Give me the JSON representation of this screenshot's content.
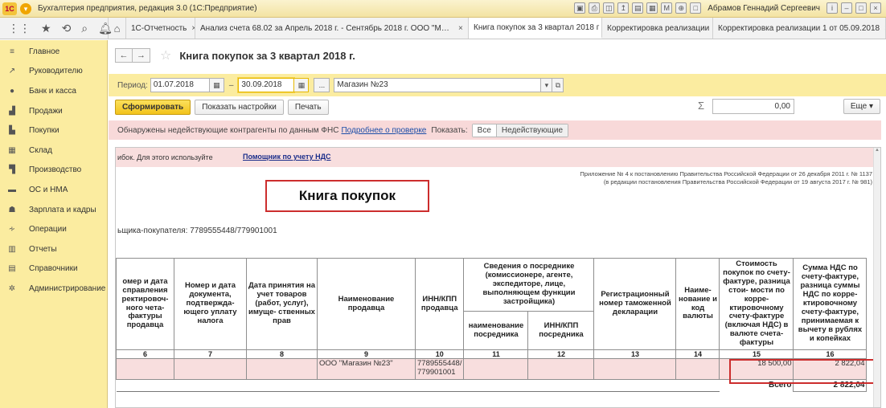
{
  "window": {
    "title": "Бухгалтерия предприятия, редакция 3.0  (1С:Предприятие)",
    "user": "Абрамов Геннадий Сергеевич"
  },
  "tabs": [
    {
      "label": "1С-Отчетность"
    },
    {
      "label": "Анализ счета 68.02 за Апрель 2018 г. - Сентябрь 2018 г. ООО \"Магазин ..."
    },
    {
      "label": "Книга покупок за 3 квартал 2018 г"
    },
    {
      "label": "Корректировка реализации"
    },
    {
      "label": "Корректировка реализации 1 от 05.09.2018"
    }
  ],
  "sidebar": {
    "items": [
      {
        "label": "Главное",
        "icon": "menu-lines-icon"
      },
      {
        "label": "Руководителю",
        "icon": "trend-icon"
      },
      {
        "label": "Банк и касса",
        "icon": "coin-icon"
      },
      {
        "label": "Продажи",
        "icon": "cart-icon"
      },
      {
        "label": "Покупки",
        "icon": "basket-icon"
      },
      {
        "label": "Склад",
        "icon": "warehouse-icon"
      },
      {
        "label": "Производство",
        "icon": "factory-icon"
      },
      {
        "label": "ОС и НМА",
        "icon": "truck-icon"
      },
      {
        "label": "Зарплата и кадры",
        "icon": "person-icon"
      },
      {
        "label": "Операции",
        "icon": "operations-icon"
      },
      {
        "label": "Отчеты",
        "icon": "bar-chart-icon"
      },
      {
        "label": "Справочники",
        "icon": "book-icon"
      },
      {
        "label": "Администрирование",
        "icon": "gear-icon"
      }
    ]
  },
  "header": {
    "title": "Книга покупок за 3 квартал 2018 г."
  },
  "filter": {
    "period_label": "Период:",
    "date_from": "01.07.2018",
    "dash": "–",
    "date_to": "30.09.2018",
    "dots": "...",
    "org": "Магазин №23"
  },
  "actions": {
    "generate": "Сформировать",
    "settings": "Показать настройки",
    "print": "Печать",
    "sum_value": "0,00",
    "more": "Еще"
  },
  "warning": {
    "text": "Обнаружены недействующие контрагенты по данным ФНС",
    "link": "Подробнее о проверке",
    "show_label": "Показать:",
    "seg_all": "Все",
    "seg_inactive": "Недействующие"
  },
  "report": {
    "pink_text": "ибок. Для этого используйте",
    "pink_link": "Помощник по учету НДС",
    "note1": "Приложение № 4 к постановлению Правительства Российской Федерации от 26 декабря 2011 г. № 1137",
    "note2": "(в редакции постановления Правительства Российской Федерации от 19 августа 2017 г. № 981)",
    "title": "Книга покупок",
    "inn_line": "ьщика-покупателя:   7789555448/779901001",
    "columns": {
      "c6": "омер и дата справления ректировоч- ного чета-фактуры продавца",
      "c7": "Номер и дата документа, подтвержда- ющего уплату налога",
      "c8": "Дата принятия на учет товаров (работ, услуг), имуще- ственных прав",
      "c9": "Наименование продавца",
      "c10": "ИНН/КПП продавца",
      "c11_12": "Сведения о посреднике (комиссионере, агенте, экспедиторе, лице, выполняющем функции застройщика)",
      "c11": "наименование посредника",
      "c12": "ИНН/КПП посредника",
      "c13": "Регистрационный номер таможенной декларации",
      "c14": "Наиме- нование и код валюты",
      "c15": "Стоимость покупок по счету-фактуре, разница стои- мости по корре- ктировочному счету-фактуре (включая НДС) в валюте счета-фактуры",
      "c16": "Сумма НДС по счету-фактуре, разница суммы НДС по корре- ктировочному счету-фактуре, принимаемая к вычету в рублях и копейках"
    },
    "numbers": [
      "6",
      "7",
      "8",
      "9",
      "10",
      "11",
      "12",
      "13",
      "14",
      "15",
      "16"
    ],
    "row": {
      "seller": "ООО \"Магазин №23\"",
      "inn": "7789555448/ 779901001",
      "cost": "18 500,00",
      "vat": "2 822,04"
    },
    "total_label": "Всего",
    "total_value": "2 822,04"
  }
}
